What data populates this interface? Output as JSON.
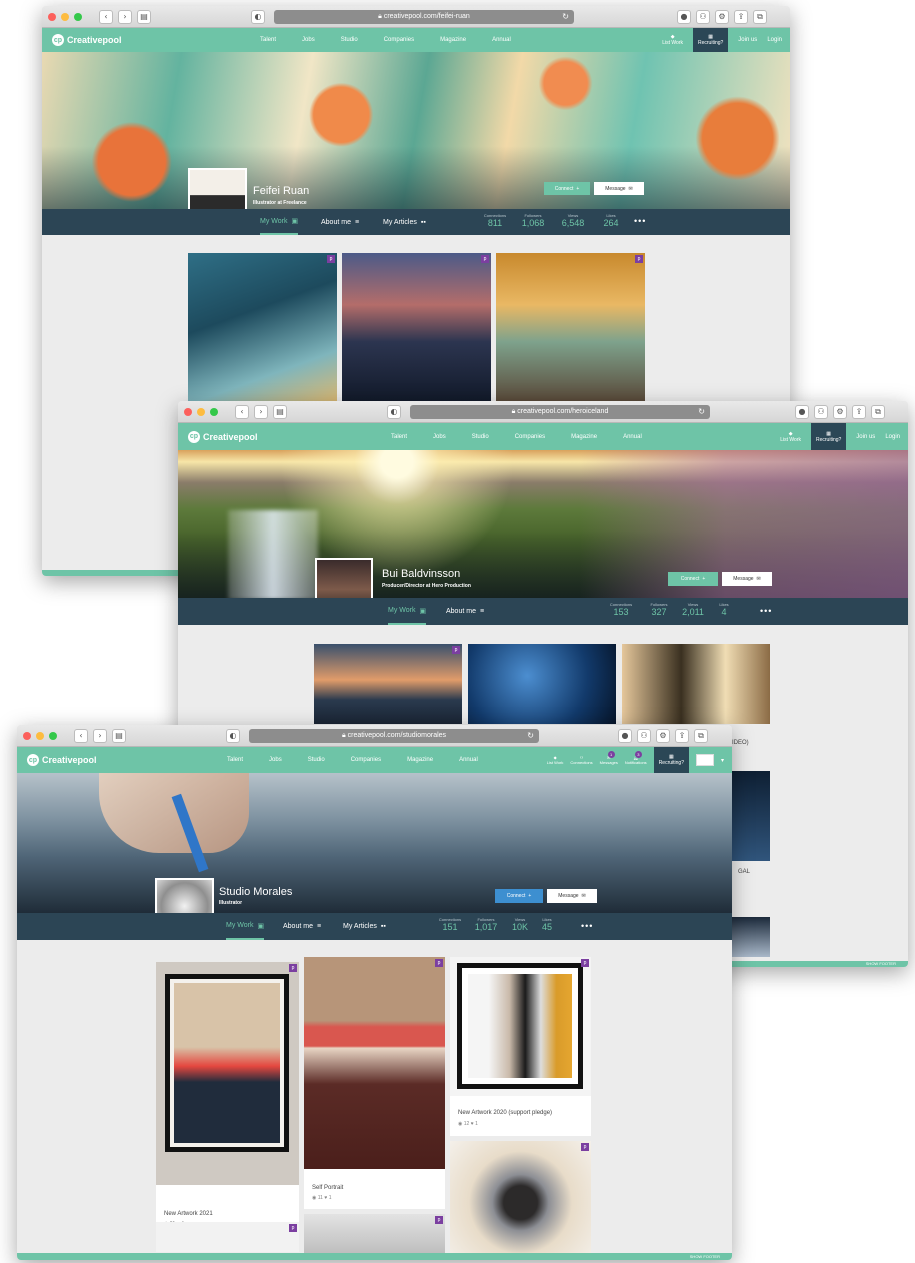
{
  "site": {
    "logo": "Creativepool",
    "logo_mark": "cp"
  },
  "nav": {
    "menu": [
      "Talent",
      "Jobs",
      "Studio",
      "Companies",
      "Magazine",
      "Annual"
    ],
    "list_work": "List Work",
    "recruiting": "Recruiting?",
    "join": "Join us",
    "login": "Login",
    "connections": "Connections",
    "messages": "Messages",
    "notifications": "Notifications",
    "msg_count": "1",
    "notif_count": "3"
  },
  "window1": {
    "url": "creativepool.com/feifei-ruan",
    "name": "Feifei Ruan",
    "role": "Illustrator at Freelance",
    "connect": "Connect",
    "message": "Message",
    "tabs": [
      "My Work",
      "About me",
      "My Articles"
    ],
    "stats": [
      {
        "label": "Connections",
        "value": "811"
      },
      {
        "label": "Followers",
        "value": "1,068"
      },
      {
        "label": "Views",
        "value": "6,548"
      },
      {
        "label": "Likes",
        "value": "264"
      }
    ]
  },
  "window2": {
    "url": "creativepool.com/heroiceland",
    "name": "Bui Baldvinsson",
    "role": "Producer/Director at Hero Production",
    "connect": "Connect",
    "message": "Message",
    "tabs": [
      "My Work",
      "About me"
    ],
    "stats": [
      {
        "label": "Connections",
        "value": "153"
      },
      {
        "label": "Followers",
        "value": "327"
      },
      {
        "label": "Views",
        "value": "2,011"
      },
      {
        "label": "Likes",
        "value": "4"
      }
    ],
    "side_text_1": "IDEO)",
    "side_text_2": "GAL",
    "footer": "SHOW FOOTER"
  },
  "window3": {
    "url": "creativepool.com/studiomorales",
    "name": "Studio Morales",
    "role": "Illustrator",
    "connect": "Connect",
    "message": "Message",
    "tabs": [
      "My Work",
      "About me",
      "My Articles"
    ],
    "stats": [
      {
        "label": "Connections",
        "value": "151"
      },
      {
        "label": "Followers",
        "value": "1,017"
      },
      {
        "label": "Views",
        "value": "10K"
      },
      {
        "label": "Likes",
        "value": "45"
      }
    ],
    "cards": [
      {
        "title": "New Artwork 2021",
        "views": "21",
        "likes": "4"
      },
      {
        "title": "Self Portrait",
        "views": "11",
        "likes": "1"
      },
      {
        "title": "New Artwork 2020 (support pledge)",
        "views": "12",
        "likes": "1"
      }
    ],
    "footer": "SHOW FOOTER"
  },
  "icons": [
    "shield-icon",
    "back-icon",
    "forward-icon",
    "sidebar-icon",
    "reload-icon",
    "lock-icon",
    "share-icon",
    "tabs-icon",
    "diamond-icon",
    "briefcase-icon",
    "user-plus-icon",
    "envelope-icon",
    "grid-icon",
    "list-icon",
    "pen-icon",
    "heart-icon",
    "eye-icon"
  ],
  "colors": {
    "brand": "#6ec4a7",
    "navy": "#2c4555",
    "badge": "#7b3fa0"
  }
}
